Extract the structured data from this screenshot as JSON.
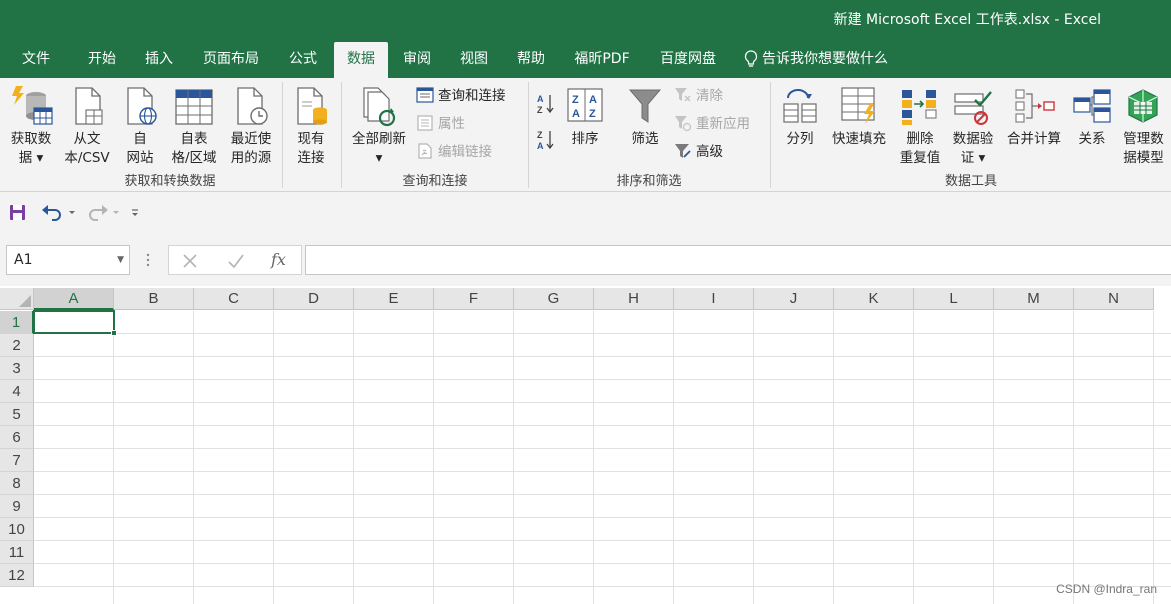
{
  "window": {
    "title": "新建 Microsoft Excel 工作表.xlsx  -  Excel"
  },
  "tabs": [
    {
      "label": "文件"
    },
    {
      "label": "开始"
    },
    {
      "label": "插入"
    },
    {
      "label": "页面布局"
    },
    {
      "label": "公式"
    },
    {
      "label": "数据"
    },
    {
      "label": "审阅"
    },
    {
      "label": "视图"
    },
    {
      "label": "帮助"
    },
    {
      "label": "福昕PDF"
    },
    {
      "label": "百度网盘"
    }
  ],
  "active_tab": "数据",
  "tell_me": "告诉我你想要做什么",
  "ribbon": {
    "get_transform": {
      "label": "获取和转换数据",
      "get_data": "获取数\n据 ▾",
      "from_text": "从文\n本/CSV",
      "from_web": "自\n网站",
      "from_table": "自表\n格/区域",
      "recent_sources": "最近使\n用的源",
      "existing_connections": "现有\n连接"
    },
    "queries": {
      "label": "查询和连接",
      "refresh_all": "全部刷新\n▾",
      "queries_connections": "查询和连接",
      "properties": "属性",
      "edit_links": "编辑链接"
    },
    "sort_filter": {
      "label": "排序和筛选",
      "sort": "排序",
      "filter": "筛选",
      "clear": "清除",
      "reapply": "重新应用",
      "advanced": "高级"
    },
    "data_tools": {
      "label": "数据工具",
      "text_to_columns": "分列",
      "flash_fill": "快速填充",
      "remove_duplicates": "删除\n重复值",
      "data_validation": "数据验\n证 ▾",
      "consolidate": "合并计算",
      "relationships": "关系",
      "manage_data_model": "管理数\n据模型"
    }
  },
  "formula_bar": {
    "name_box": "A1",
    "fx": "fx",
    "formula": ""
  },
  "sheet": {
    "columns": [
      "A",
      "B",
      "C",
      "D",
      "E",
      "F",
      "G",
      "H",
      "I",
      "J",
      "K",
      "L",
      "M",
      "N"
    ],
    "rows": [
      "1",
      "2",
      "3",
      "4",
      "5",
      "6",
      "7",
      "8",
      "9",
      "10",
      "11",
      "12"
    ],
    "selected_cell": "A1"
  },
  "watermark": "CSDN @Indra_ran",
  "colors": {
    "accent": "#217346",
    "ribbon_bg": "#f3f3f3"
  }
}
